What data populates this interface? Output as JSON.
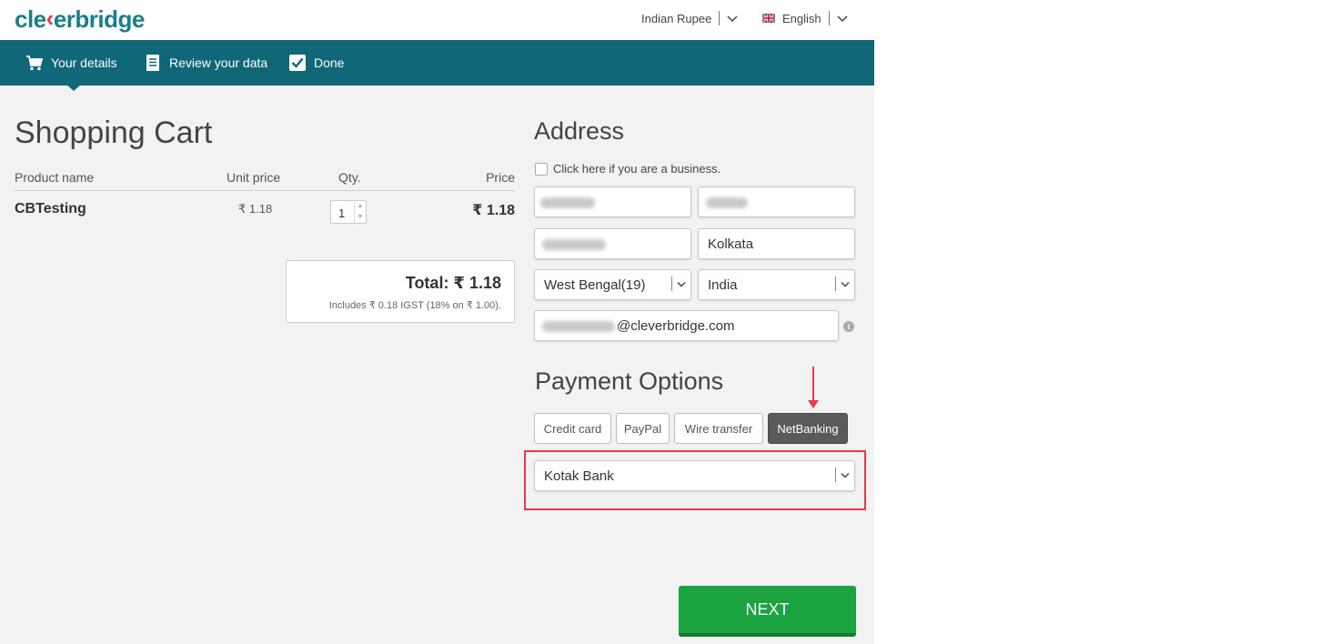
{
  "header": {
    "logo_text_pre": "cle",
    "logo_text_post": "erbridge",
    "currency": "Indian Rupee",
    "language": "English"
  },
  "steps": [
    {
      "label": "Your details",
      "icon": "cart-icon"
    },
    {
      "label": "Review your data",
      "icon": "document-icon"
    },
    {
      "label": "Done",
      "icon": "checkbox-icon"
    }
  ],
  "cart": {
    "title": "Shopping Cart",
    "columns": [
      "Product name",
      "Unit price",
      "Qty.",
      "Price"
    ],
    "items": [
      {
        "name": "CBTesting",
        "unit_price": "₹ 1.18",
        "qty": "1",
        "price": "₹ 1.18"
      }
    ],
    "total": "Total: ₹ 1.18",
    "tax_note": "Includes ₹ 0.18 IGST (18% on ₹ 1.00)."
  },
  "address": {
    "title": "Address",
    "business_checkbox": "Click here if you are a business.",
    "city": "Kolkata",
    "state": "West Bengal(19)",
    "country": "India",
    "email_suffix": "@cleverbridge.com"
  },
  "payment": {
    "title": "Payment Options",
    "options": [
      "Credit card",
      "PayPal",
      "Wire transfer",
      "NetBanking"
    ],
    "selected": "NetBanking",
    "bank": "Kotak Bank"
  },
  "actions": {
    "next_label": "NEXT"
  },
  "colors": {
    "brand_teal": "#0f6777",
    "logo_teal": "#1b7f8a",
    "accent_red": "#e8374f",
    "next_green": "#1aa33f"
  }
}
